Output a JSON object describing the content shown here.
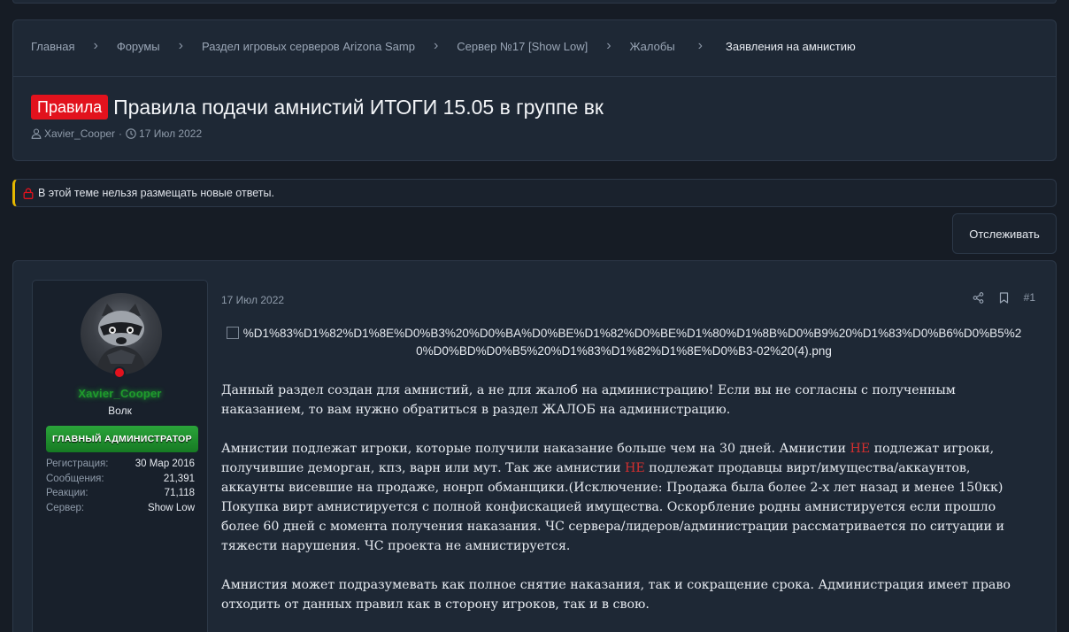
{
  "breadcrumbs": [
    {
      "label": "Главная"
    },
    {
      "label": "Форумы"
    },
    {
      "label": "Раздел игровых серверов Arizona Samp"
    },
    {
      "label": "Сервер №17 [Show Low]"
    },
    {
      "label": "Жалобы"
    },
    {
      "label": "Заявления на амнистию"
    }
  ],
  "thread": {
    "prefix": "Правила",
    "title": "Правила подачи амнистий ИТОГИ 15.05 в группе вк",
    "author": "Xavier_Cooper",
    "separator": "·",
    "date": "17 Июл 2022",
    "prefix_color": "#e2121d"
  },
  "notice": {
    "text": "В этой теме нельзя размещать новые ответы.",
    "accent": "#e6b800"
  },
  "watch_button": {
    "label": "Отслеживать"
  },
  "user": {
    "username": "Xavier_Cooper",
    "title": "Волк",
    "role": "ГЛАВНЫЙ АДМИНИСТРАТОР",
    "name_color": "#1f9b2c",
    "stats": [
      {
        "label": "Регистрация:",
        "value": "30 Мар 2016"
      },
      {
        "label": "Сообщения:",
        "value": "21,391"
      },
      {
        "label": "Реакции:",
        "value": "71,118"
      },
      {
        "label": "Сервер:",
        "value": "Show Low"
      }
    ]
  },
  "post": {
    "date": "17 Июл 2022",
    "number": "#1",
    "image_alt_line1": "%D1%83%D1%82%D1%8E%D0%B3%20%D0%BA%D0%BE%D1%82%D0%BE%D1%80%D1%8B%D0%B9%20%D1%83%D0%B6%D0%B5%2",
    "image_alt_line2": "0%D0%BD%D0%B5%20%D1%83%D1%82%D1%8E%D0%B3-02%20(4).png",
    "p1": "Данный раздел создан для амнистий, а не для жалоб на администрацию! Если вы не согласны с полученным наказанием, то вам нужно обратиться в раздел ЖАЛОБ на администрацию.",
    "p2_a": "Амнистии подлежат игроки, которые получили наказание больше чем на 30 дней. Амнистии ",
    "p2_ne1": "НЕ",
    "p2_b": " подлежат игроки, получившие деморган, кпз, варн или мут. Так же амнистии ",
    "p2_ne2": "НЕ",
    "p2_c": " подлежат продавцы вирт/имущества/аккаунтов, аккаунты висевшие на продаже, нонрп обманщики.(Исключение: Продажа была более 2-х лет назад и менее 150кк) Покупка вирт амнистируется с полной конфискацией имущества. Оскорбление родны амнистируется если прошло более 60 дней с момента получения наказания. ЧС сервера/лидеров/администрации рассматривается по ситуации и тяжести нарушения. ЧС проекта не амнистируется.",
    "p3": "Амнистия может подразумевать как полное снятие наказания, так и сокращение срока. Администрация имеет право отходить от данных правил как в сторону игроков, так и в свою."
  }
}
